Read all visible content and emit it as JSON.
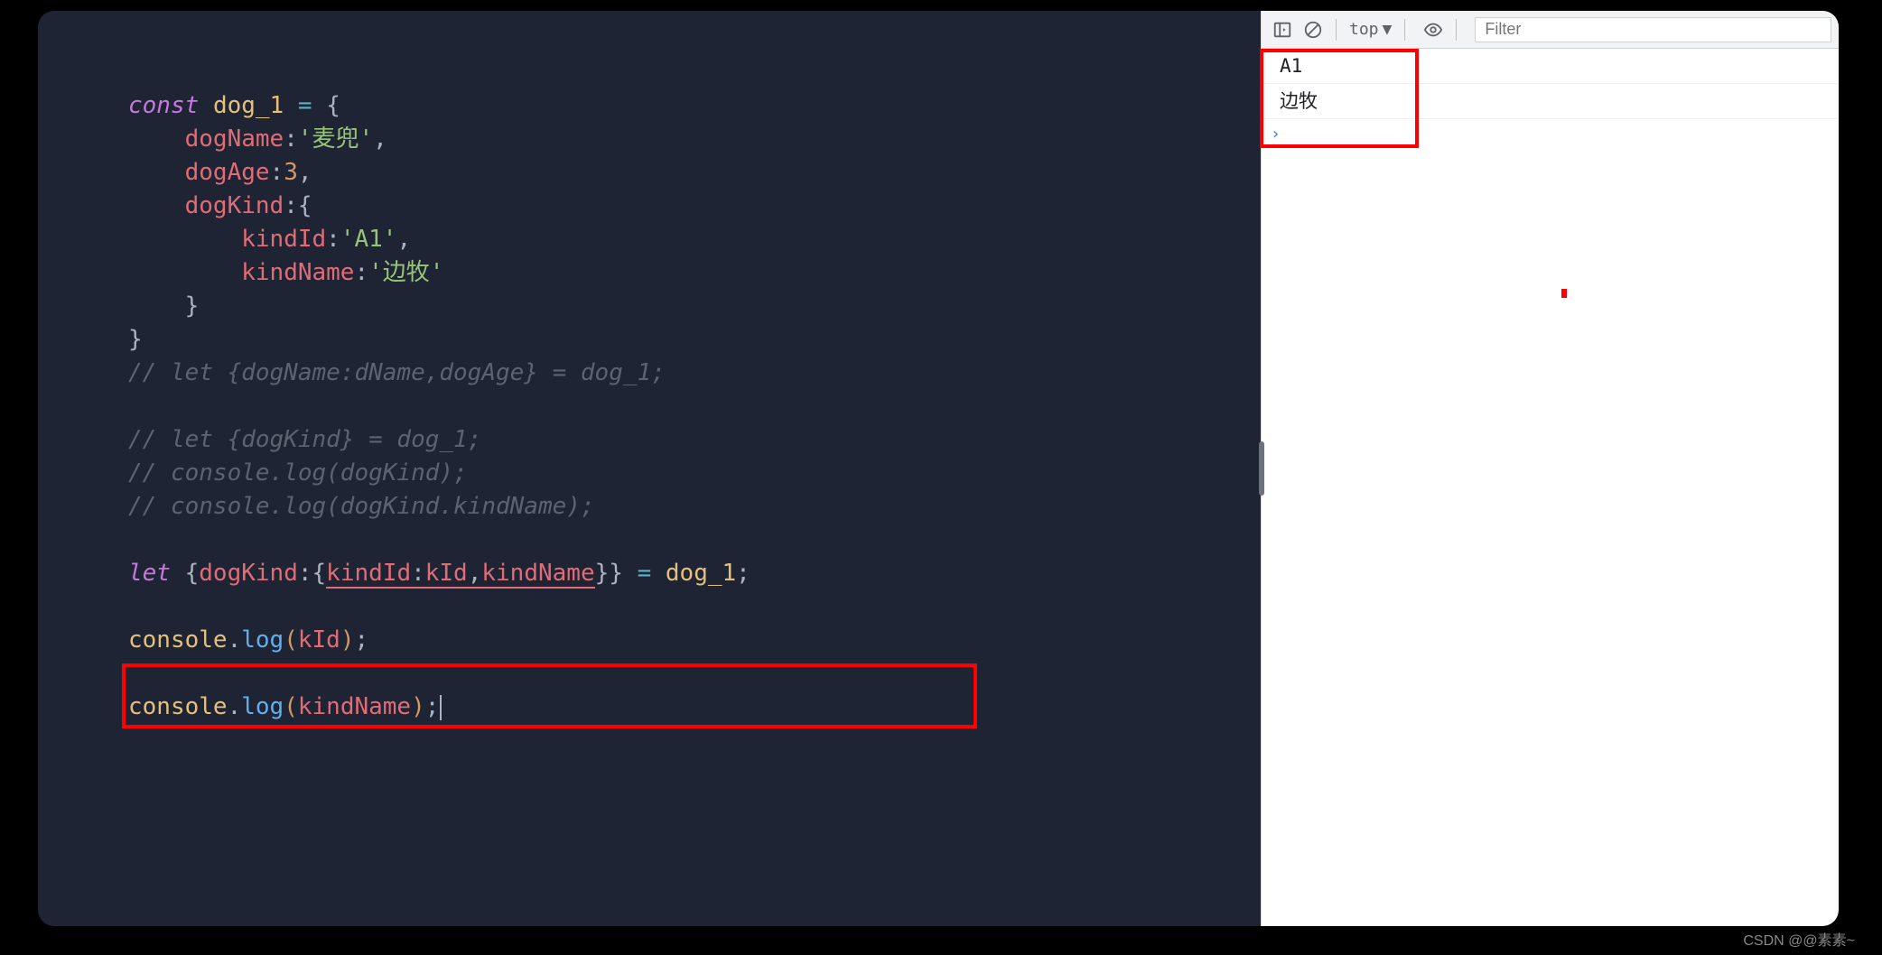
{
  "code": {
    "line1_keyword": "const",
    "line1_var": "dog_1",
    "line1_op": " = ",
    "line1_brace": "{",
    "line2_prop": "dogName",
    "line2_colon": ":",
    "line2_val": "'麦兜'",
    "line2_comma": ",",
    "line3_prop": "dogAge",
    "line3_colon": ":",
    "line3_val": "3",
    "line3_comma": ",",
    "line4_prop": "dogKind",
    "line4_colon": ":",
    "line4_brace": "{",
    "line5_prop": "kindId",
    "line5_colon": ":",
    "line5_val": "'A1'",
    "line5_comma": ",",
    "line6_prop": "kindName",
    "line6_colon": ":",
    "line6_val": "'边牧'",
    "line7_brace": "}",
    "line8_brace": "}",
    "comment1": "// let {dogName:dName,dogAge} = dog_1;",
    "comment2": "// let {dogKind} = dog_1;",
    "comment3": "// console.log(dogKind);",
    "comment4": "// console.log(dogKind.kindName);",
    "line14_keyword": "let",
    "line14_brace1": " {",
    "line14_prop1": "dogKind",
    "line14_colon1": ":",
    "line14_brace2": "{",
    "line14_prop2": "kindId",
    "line14_colon2": ":",
    "line14_prop3": "kId",
    "line14_comma": ",",
    "line14_prop4": "kindName",
    "line14_brace3": "}}",
    "line14_op": " = ",
    "line14_var": "dog_1",
    "line14_semi": ";",
    "log1_obj": "console",
    "log1_dot": ".",
    "log1_func": "log",
    "log1_paren1": "(",
    "log1_arg": "kId",
    "log1_paren2": ")",
    "log1_semi": ";",
    "log2_obj": "console",
    "log2_dot": ".",
    "log2_func": "log",
    "log2_paren1": "(",
    "log2_arg": "kindName",
    "log2_paren2": ")",
    "log2_semi": ";"
  },
  "toolbar": {
    "context": "top",
    "filter_placeholder": "Filter"
  },
  "console": {
    "output1": "A1",
    "output2": "边牧",
    "prompt": "›"
  },
  "watermark": "CSDN @@素素~"
}
